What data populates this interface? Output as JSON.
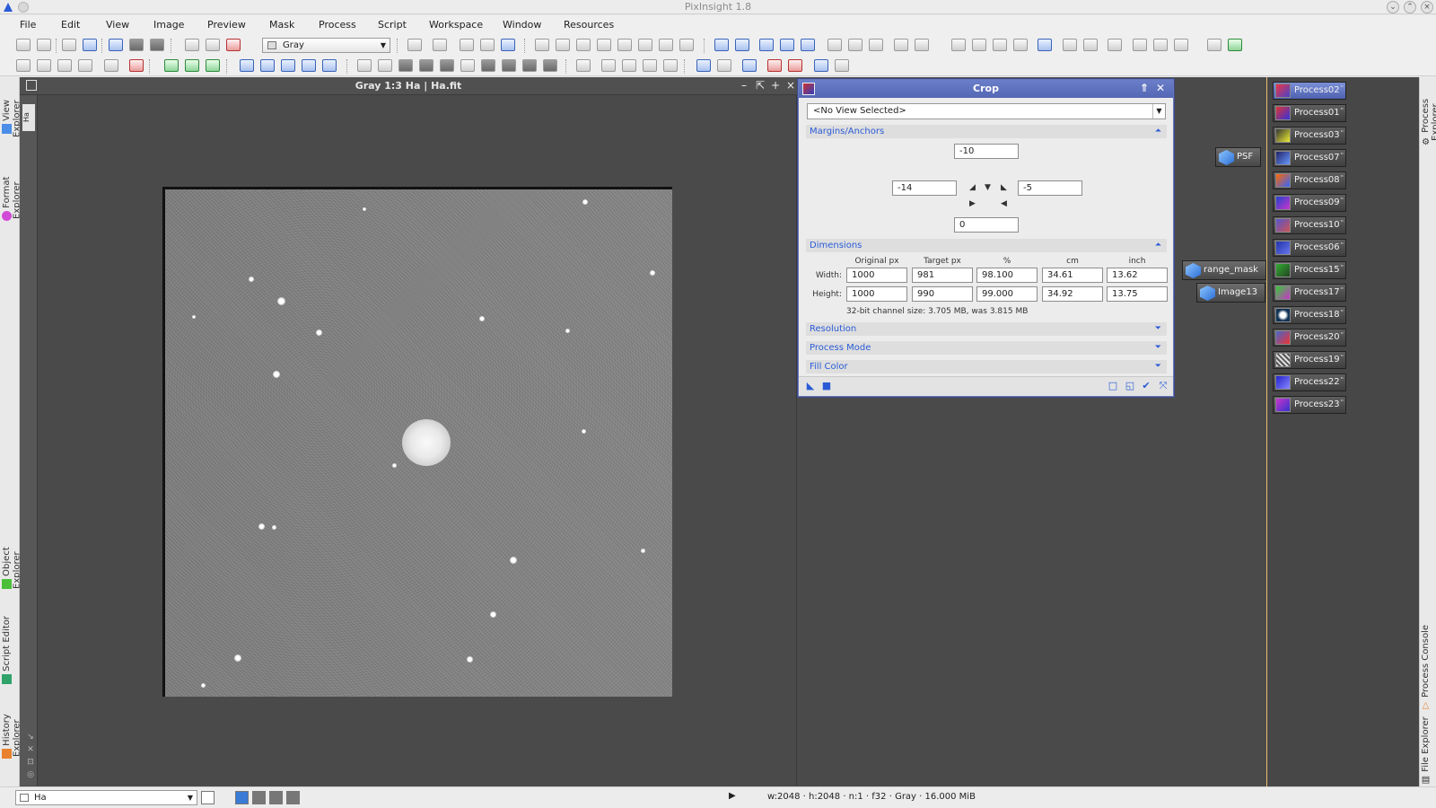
{
  "app": {
    "title": "PixInsight 1.8"
  },
  "menu": [
    "File",
    "Edit",
    "View",
    "Image",
    "Preview",
    "Mask",
    "Process",
    "Script",
    "Workspace",
    "Window",
    "Resources"
  ],
  "toolbar": {
    "colorspace_combo": "Gray"
  },
  "left_dock": [
    "View Explorer",
    "Format Explorer",
    "Object Explorer",
    "Script Editor",
    "History Explorer"
  ],
  "right_dock": [
    "Process Explorer",
    "Process Console",
    "File Explorer"
  ],
  "image_window": {
    "title": "Gray 1:3 Ha | Ha.fit",
    "side_tab": "Ha"
  },
  "crop": {
    "title": "Crop",
    "view_selector": "<No View Selected>",
    "margins_section": "Margins/Anchors",
    "top": "-10",
    "left": "-14",
    "right": "-5",
    "bottom": "0",
    "dimensions_section": "Dimensions",
    "columns": [
      "Original px",
      "Target px",
      "%",
      "cm",
      "inch"
    ],
    "width_label": "Width:",
    "height_label": "Height:",
    "width": [
      "1000",
      "981",
      "98.100",
      "34.61",
      "13.62"
    ],
    "height": [
      "1000",
      "990",
      "99.000",
      "34.92",
      "13.75"
    ],
    "info": "32-bit channel size: 3.705 MB, was 3.815 MB",
    "sections": [
      "Resolution",
      "Process Mode",
      "Fill Color"
    ]
  },
  "process_icons": [
    "Process02",
    "Process01",
    "Process03",
    "Process07",
    "Process08",
    "Process09",
    "Process10",
    "Process06",
    "Process15",
    "Process17",
    "Process18",
    "Process20",
    "Process19",
    "Process22",
    "Process23"
  ],
  "floating_icons": [
    "PSF",
    "range_mask",
    "Image13"
  ],
  "status": {
    "view": "Ha",
    "info": "w:2048 · h:2048 · n:1 · f32 · Gray · 16.000 MiB"
  },
  "colors": {
    "accent": "#5467b4",
    "section_text": "#2a5bd7",
    "workspace": "#4a4a4a"
  }
}
